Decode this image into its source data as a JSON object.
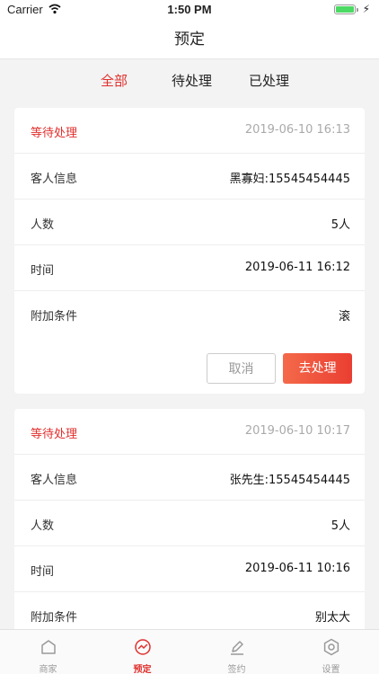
{
  "status_bar": {
    "carrier": "Carrier",
    "time": "1:50 PM",
    "battery_level": 1.0,
    "charging_icon": "bolt-icon"
  },
  "nav": {
    "title": "预定"
  },
  "tabs": [
    {
      "label": "全部",
      "active": true
    },
    {
      "label": "待处理",
      "active": false
    },
    {
      "label": "已处理",
      "active": false
    }
  ],
  "orders": [
    {
      "status": "等待处理",
      "created": "2019-06-10 16:13",
      "guest_label": "客人信息",
      "guest": "黑寡妇:15545454445",
      "count_label": "人数",
      "count": "5人",
      "time_label": "时间",
      "time": "2019-06-11 16:12",
      "extra_label": "附加条件",
      "extra": "滚",
      "cancel_label": "取消",
      "process_label": "去处理"
    },
    {
      "status": "等待处理",
      "created": "2019-06-10 10:17",
      "guest_label": "客人信息",
      "guest": "张先生:15545454445",
      "count_label": "人数",
      "count": "5人",
      "time_label": "时间",
      "time": "2019-06-11 10:16",
      "extra_label": "附加条件",
      "extra": "别太大"
    }
  ],
  "tab_bar": [
    {
      "label": "商家",
      "icon": "home-icon",
      "active": false
    },
    {
      "label": "预定",
      "icon": "trend-icon",
      "active": true
    },
    {
      "label": "签约",
      "icon": "pen-icon",
      "active": false
    },
    {
      "label": "设置",
      "icon": "gear-icon",
      "active": false
    }
  ],
  "colors": {
    "accent": "#e0302d",
    "inactive": "#999999"
  }
}
